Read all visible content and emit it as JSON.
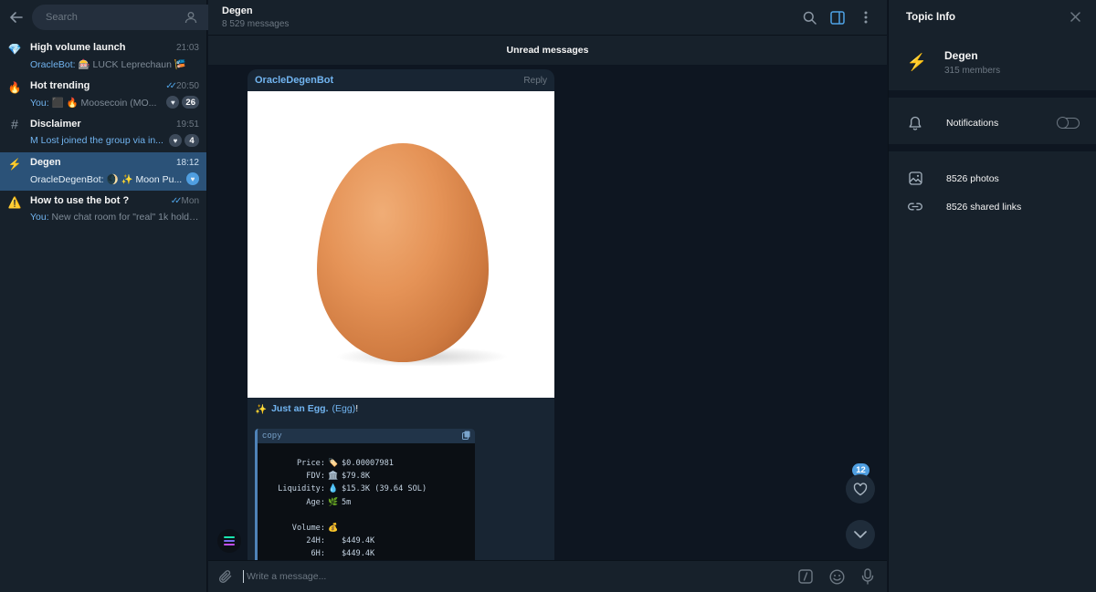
{
  "sidebar": {
    "search_placeholder": "Search",
    "chats": [
      {
        "emoji": "💎",
        "title": "High volume launch",
        "time": "21:03",
        "checks": "",
        "from": "OracleBot:",
        "preview": " 🎰 LUCK Leprechaun 🎏",
        "heart": false,
        "count": ""
      },
      {
        "emoji": "🔥",
        "title": "Hot trending",
        "time": "20:50",
        "checks": "✓✓",
        "from": "You:",
        "preview": " ⬛ 🔥 Moosecoin (MO...",
        "heart": true,
        "count": "26"
      },
      {
        "emoji": "#",
        "title": "Disclaimer",
        "time": "19:51",
        "checks": "",
        "from": "",
        "preview": "M Lost joined the group via in...",
        "heart": true,
        "count": "4"
      },
      {
        "emoji": "⚡",
        "title": "Degen",
        "time": "18:12",
        "checks": "",
        "from": "OracleDegenBot:",
        "preview": " 🌒 ✨ Moon Pu...",
        "heart": true,
        "count": ""
      },
      {
        "emoji": "⚠️",
        "title": "How to use the bot ?",
        "time": "Mon",
        "checks": "✓✓",
        "from": "You:",
        "preview": " New chat room for \"real\" 1k holde...",
        "heart": false,
        "count": ""
      }
    ]
  },
  "topbar": {
    "title": "Degen",
    "subtitle": "8 529 messages"
  },
  "unread_label": "Unread messages",
  "message": {
    "sender": "OracleDegenBot",
    "reply_label": "Reply",
    "caption_spark": "✨",
    "caption_name": "Just an Egg.",
    "caption_tag": "(Egg)",
    "caption_end": "!",
    "code_label": "copy",
    "code_lines": [
      {
        "key": "Price:",
        "emoji": "🏷️",
        "value": "$0.00007981"
      },
      {
        "key": "FDV:",
        "emoji": "🏛️",
        "value": "$79.8K"
      },
      {
        "key": "Liquidity:",
        "emoji": "💧",
        "value": "$15.3K (39.64 SOL)"
      },
      {
        "key": "Age:",
        "emoji": "🌿",
        "value": "5m"
      },
      {
        "key": "",
        "emoji": "",
        "value": ""
      },
      {
        "key": "Volume:",
        "emoji": "💰",
        "value": ""
      },
      {
        "key": "24H:",
        "emoji": "",
        "value": "$449.4K"
      },
      {
        "key": "6H:",
        "emoji": "",
        "value": "$449.4K"
      }
    ]
  },
  "reactions_count": "12",
  "composer": {
    "placeholder": "Write a message..."
  },
  "info_panel": {
    "title": "Topic Info",
    "group_icon": "⚡",
    "group_name": "Degen",
    "members": "315 members",
    "notifications_label": "Notifications",
    "notifications_on": false,
    "photos": "8526 photos",
    "links": "8526 shared links"
  },
  "colors": {
    "background": "#0e1621",
    "panel": "#17212b",
    "active_chat": "#2b5278",
    "accent": "#71b4f0",
    "badge": "#4f9ee0"
  }
}
